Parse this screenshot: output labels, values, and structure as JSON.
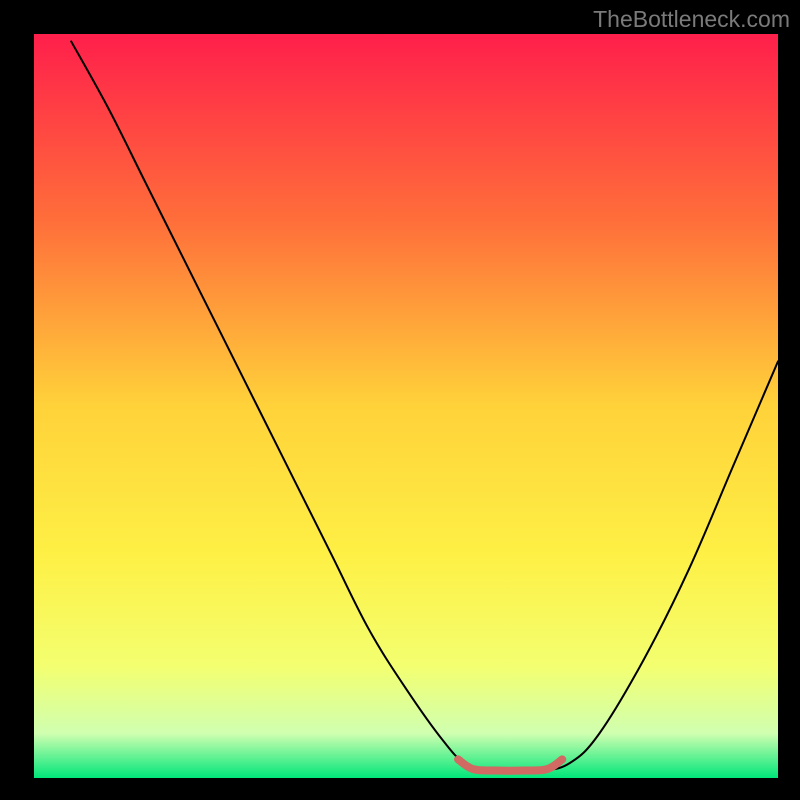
{
  "watermark": "TheBottleneck.com",
  "chart_data": {
    "type": "line",
    "title": "",
    "xlabel": "",
    "ylabel": "",
    "xlim": [
      0,
      100
    ],
    "ylim": [
      0,
      100
    ],
    "gradient_stops": [
      {
        "offset": 0,
        "color": "#ff1f4b"
      },
      {
        "offset": 25,
        "color": "#ff6e3a"
      },
      {
        "offset": 50,
        "color": "#ffd23a"
      },
      {
        "offset": 70,
        "color": "#fef045"
      },
      {
        "offset": 85,
        "color": "#f3ff70"
      },
      {
        "offset": 94,
        "color": "#d0ffb0"
      },
      {
        "offset": 100,
        "color": "#00e67a"
      }
    ],
    "series": [
      {
        "name": "bottleneck-curve",
        "color": "#000000",
        "width": 2,
        "points": [
          {
            "x": 5,
            "y": 99
          },
          {
            "x": 10,
            "y": 90
          },
          {
            "x": 15,
            "y": 80
          },
          {
            "x": 20,
            "y": 70
          },
          {
            "x": 25,
            "y": 60
          },
          {
            "x": 30,
            "y": 50
          },
          {
            "x": 35,
            "y": 40
          },
          {
            "x": 40,
            "y": 30
          },
          {
            "x": 45,
            "y": 20
          },
          {
            "x": 50,
            "y": 12
          },
          {
            "x": 55,
            "y": 5
          },
          {
            "x": 58,
            "y": 2
          },
          {
            "x": 62,
            "y": 1
          },
          {
            "x": 68,
            "y": 1
          },
          {
            "x": 72,
            "y": 2
          },
          {
            "x": 76,
            "y": 6
          },
          {
            "x": 82,
            "y": 16
          },
          {
            "x": 88,
            "y": 28
          },
          {
            "x": 94,
            "y": 42
          },
          {
            "x": 100,
            "y": 56
          }
        ]
      },
      {
        "name": "optimal-zone",
        "color": "#d16a63",
        "width": 8,
        "points": [
          {
            "x": 57,
            "y": 2.5
          },
          {
            "x": 59,
            "y": 1.2
          },
          {
            "x": 62,
            "y": 1
          },
          {
            "x": 66,
            "y": 1
          },
          {
            "x": 69,
            "y": 1.2
          },
          {
            "x": 71,
            "y": 2.5
          }
        ]
      }
    ]
  }
}
